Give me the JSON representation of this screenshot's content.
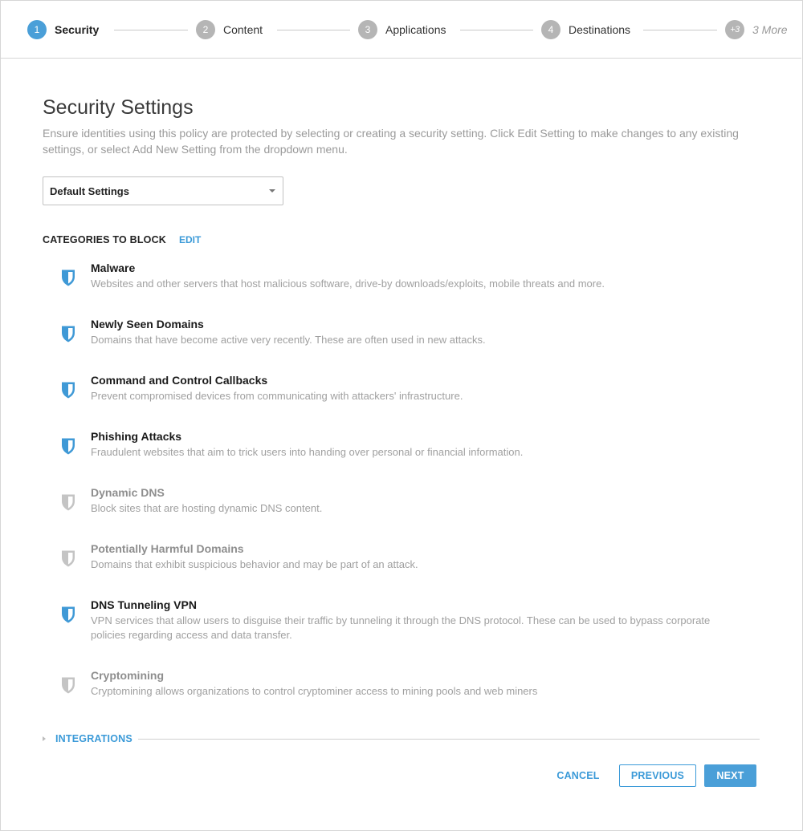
{
  "stepper": {
    "steps": [
      {
        "num": "1",
        "label": "Security",
        "state": "active"
      },
      {
        "num": "2",
        "label": "Content",
        "state": "inactive"
      },
      {
        "num": "3",
        "label": "Applications",
        "state": "inactive"
      },
      {
        "num": "4",
        "label": "Destinations",
        "state": "inactive"
      },
      {
        "num": "+3",
        "label": "3 More",
        "state": "more"
      }
    ]
  },
  "main": {
    "title": "Security Settings",
    "description": "Ensure identities using this policy are protected by selecting or creating a security setting. Click Edit Setting to make changes to any existing settings, or select Add New Setting from the dropdown menu.",
    "dropdown": {
      "value": "Default Settings",
      "icon": "chevron-down-icon"
    },
    "categories_heading": "CATEGORIES TO BLOCK",
    "edit_label": "EDIT",
    "categories": [
      {
        "name": "Malware",
        "desc": "Websites and other servers that host malicious software, drive-by downloads/exploits, mobile threats and more.",
        "enabled": true,
        "icon": "shield-icon"
      },
      {
        "name": "Newly Seen Domains",
        "desc": "Domains that have become active very recently. These are often used in new attacks.",
        "enabled": true,
        "icon": "shield-icon"
      },
      {
        "name": "Command and Control Callbacks",
        "desc": "Prevent compromised devices from communicating with attackers' infrastructure.",
        "enabled": true,
        "icon": "shield-icon"
      },
      {
        "name": "Phishing Attacks",
        "desc": "Fraudulent websites that aim to trick users into handing over personal or financial information.",
        "enabled": true,
        "icon": "shield-icon"
      },
      {
        "name": "Dynamic DNS",
        "desc": "Block sites that are hosting dynamic DNS content.",
        "enabled": false,
        "icon": "shield-icon"
      },
      {
        "name": "Potentially Harmful Domains",
        "desc": "Domains that exhibit suspicious behavior and may be part of an attack.",
        "enabled": false,
        "icon": "shield-icon"
      },
      {
        "name": "DNS Tunneling VPN",
        "desc": "VPN services that allow users to disguise their traffic by tunneling it through the DNS protocol. These can be used to bypass corporate policies regarding access and data transfer.",
        "enabled": true,
        "icon": "shield-icon"
      },
      {
        "name": "Cryptomining",
        "desc": "Cryptomining allows organizations to control cryptominer access to mining pools and web miners",
        "enabled": false,
        "icon": "shield-icon"
      }
    ],
    "integrations_label": "INTEGRATIONS"
  },
  "footer": {
    "cancel": "CANCEL",
    "previous": "PREVIOUS",
    "next": "NEXT"
  },
  "colors": {
    "accent": "#4a9fd8",
    "link": "#3b9ad8",
    "shield_enabled": "#3f99d6",
    "shield_disabled": "#c4c4c4"
  }
}
